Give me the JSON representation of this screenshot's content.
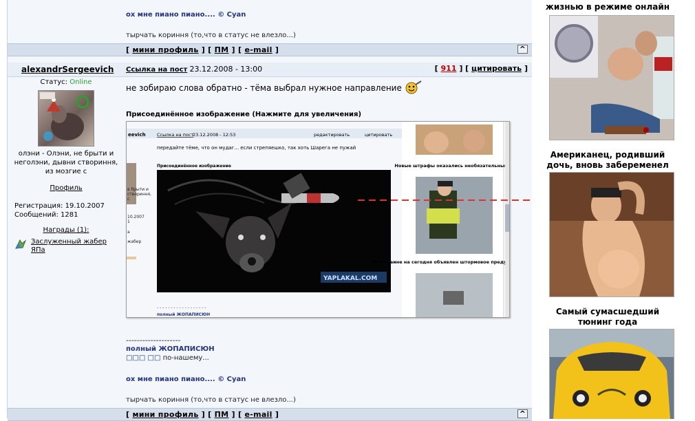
{
  "top_post": {
    "sig_line": "ох мне пиано пиано.... © Cyan",
    "status_line": "тырчать кориння (то,что в статус не влезло...)"
  },
  "footer_bar": {
    "mini_profile": "мини профиль",
    "pm": "ПМ",
    "email": "e-mail",
    "up": "^"
  },
  "post": {
    "author": "alexandrSergeevich",
    "status_label": "Статус:",
    "status_value": "Online",
    "user_title": "олэни - Олэни, не брыти и неголэни, дывни створиння, из мозгие с",
    "profile_link": "Профиль",
    "registration": "Регистрация: 19.10.2007",
    "messages": "Сообщений: 1281",
    "awards_label": "Награды (1):",
    "award_name": "Заслуженный жабер ЯПа",
    "link_label": "Ссылка на пост",
    "date": "23.12.2008 - 13:00",
    "rating": "911",
    "cite": "цитировать",
    "message": "не зобираю слова обратно - тёма выбрал нужное направление",
    "attachment_label": "Присоединённое изображение (Нажмите для увеличения)",
    "separator": "--------------------",
    "sig_nick": "полный ЖОПАПИСЮН",
    "sig_suffix": "по-нашему...",
    "sig_line": "ох мне пиано пиано.... © Cyan",
    "status_line": "тырчать кориння (то,что в статус не влезло...)"
  },
  "attachment": {
    "author_fragment": "eevich",
    "link_label": "Ссылка на пост",
    "date": "23.12.2008 - 12:53",
    "edit": "редактировать",
    "cite": "цитировать",
    "message": "передайте тёме, что он мудаг... если стрепяешко, так хоть Шарега не пужай",
    "attachment_label": "Присоединённое изображение",
    "watermark": "YAPLAKAL.COM",
    "news1": "Новые штрафы оказались необязательными?",
    "news2": "По Украине на сегодня объявлен штормовое предупреждение",
    "left_text": [
      "в брыти и",
      "створиння,",
      "с",
      "10.2007",
      "1",
      "а",
      "жабер"
    ],
    "bottom_text": "полный ЖОПАПИСЮН"
  },
  "sidebar": {
    "item0_title": "жизнью в режиме онлайн",
    "item1_title": "Американец, родивший дочь, вновь забеременел",
    "item2_title": "Самый сумасшедший тюнинг года"
  },
  "colors": {
    "online": "#2e9e2e",
    "rating": "#cc0000",
    "sig": "#24347c",
    "bar": "#d5dfec"
  }
}
